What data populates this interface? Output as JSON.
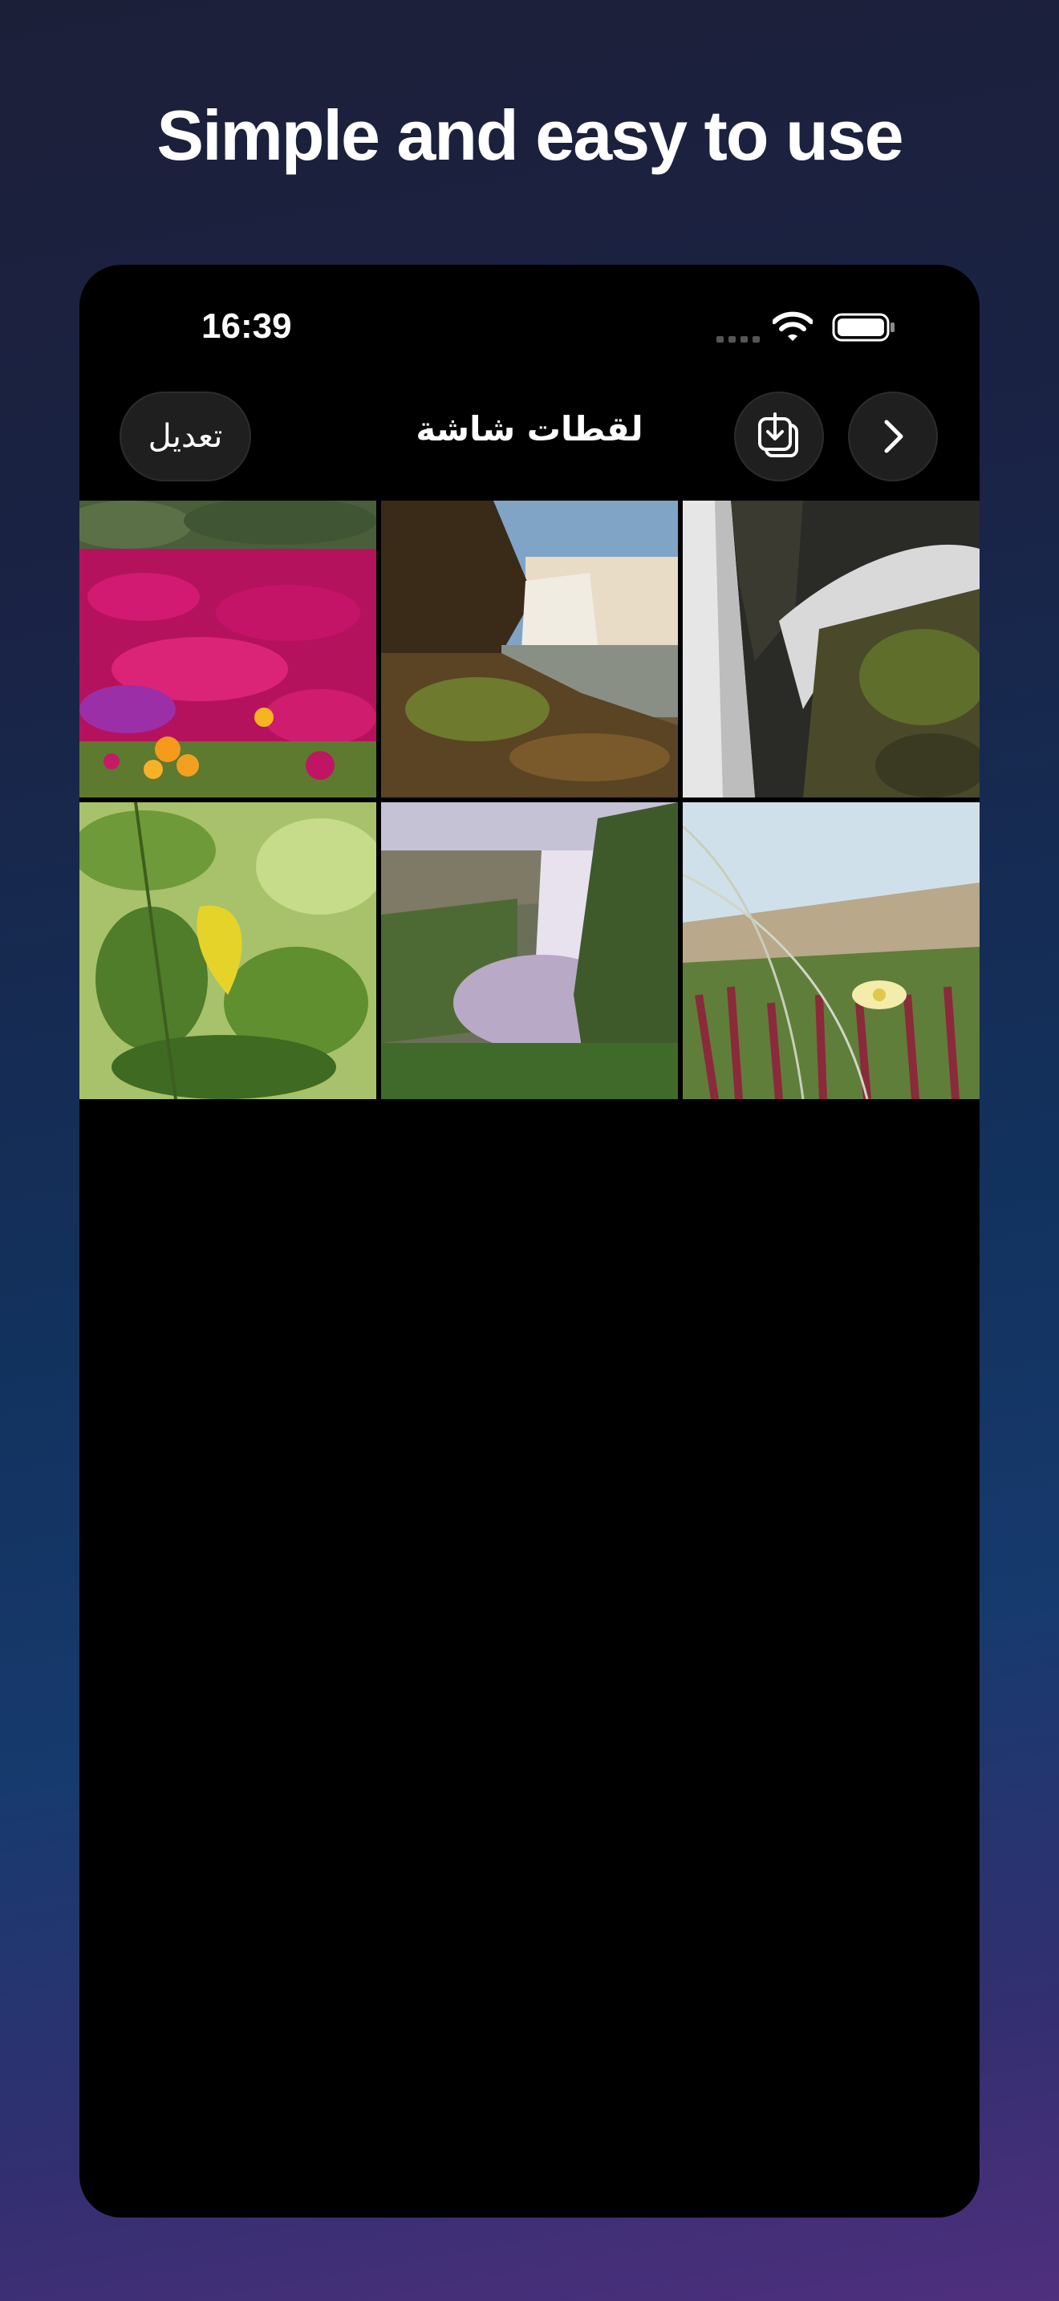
{
  "headline": "Simple and easy to use",
  "status_bar": {
    "time": "16:39"
  },
  "nav": {
    "edit_label": "تعديل",
    "title": "لقطات شاشة"
  },
  "photos": [
    {
      "name": "pink-flowers-photo"
    },
    {
      "name": "waterfall-coast-photo"
    },
    {
      "name": "long-exposure-waterfall-photo"
    },
    {
      "name": "green-leaves-photo"
    },
    {
      "name": "misty-waterfall-photo"
    },
    {
      "name": "dune-flower-photo"
    }
  ]
}
